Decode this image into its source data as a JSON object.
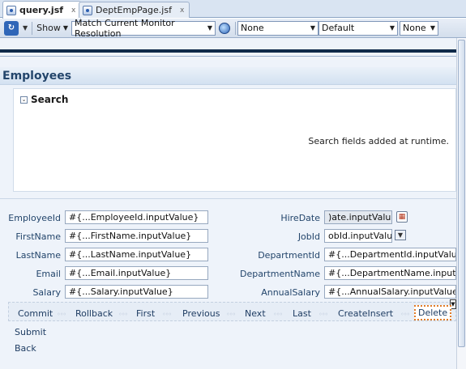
{
  "tabs": [
    {
      "label": "query.jsf",
      "active": true,
      "close": "x"
    },
    {
      "label": "DeptEmpPage.jsf",
      "active": false,
      "close": "x"
    }
  ],
  "toolbar": {
    "show_label": "Show",
    "resolution": "Match Current Monitor Resolution",
    "select1": "None",
    "select2": "Default",
    "select3": "None"
  },
  "panel": {
    "title": "Employees",
    "search_title": "Search",
    "search_note": "Search fields added at runtime."
  },
  "form": {
    "left": [
      {
        "label": "EmployeeId",
        "value": "#{...EmployeeId.inputValue}"
      },
      {
        "label": "FirstName",
        "value": "#{...FirstName.inputValue}"
      },
      {
        "label": "LastName",
        "value": "#{...LastName.inputValue}"
      },
      {
        "label": "Email",
        "value": "#{...Email.inputValue}"
      },
      {
        "label": "Salary",
        "value": "#{...Salary.inputValue}"
      }
    ],
    "right": [
      {
        "label": "HireDate",
        "value": ")ate.inputValue}"
      },
      {
        "label": "JobId",
        "value": "obId.inputValue}"
      },
      {
        "label": "DepartmentId",
        "value": "#{...DepartmentId.inputValue}"
      },
      {
        "label": "DepartmentName",
        "value": "#{...DepartmentName.inputValue"
      },
      {
        "label": "AnnualSalary",
        "value": "#{...AnnualSalary.inputValue}"
      }
    ]
  },
  "buttons": [
    "Commit",
    "Rollback",
    "First",
    "Previous",
    "Next",
    "Last",
    "CreateInsert",
    "Delete"
  ],
  "extra_buttons": [
    "Submit",
    "Back"
  ],
  "colors": {
    "accent": "#23456b",
    "navy_bar": "#0f2a4a",
    "focus": "#e17b26"
  }
}
